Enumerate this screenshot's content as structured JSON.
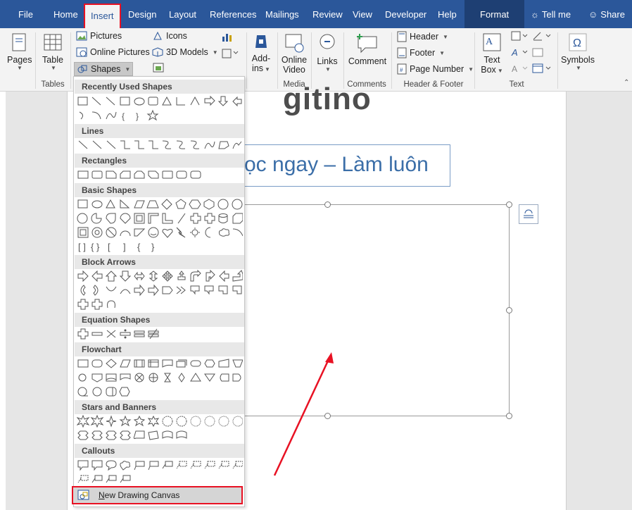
{
  "tabs": [
    "File",
    "Home",
    "Insert",
    "Design",
    "Layout",
    "References",
    "Mailings",
    "Review",
    "View",
    "Developer",
    "Help",
    "Format"
  ],
  "tell_me": "Tell me",
  "share": "Share",
  "ribbon": {
    "pages": "Pages",
    "table": "Table",
    "pictures": "Pictures",
    "online_pictures": "Online Pictures",
    "shapes": "Shapes",
    "icons": "Icons",
    "models_3d": "3D Models",
    "addins_line1": "Add-",
    "addins_line2": "ins",
    "online_video_line1": "Online",
    "online_video_line2": "Video",
    "links": "Links",
    "comment": "Comment",
    "header": "Header",
    "footer": "Footer",
    "page_number": "Page Number",
    "text_box_line1": "Text",
    "text_box_line2": "Box",
    "symbols": "Symbols",
    "groups": {
      "tables": "Tables",
      "media": "Media",
      "comments": "Comments",
      "header_footer": "Header & Footer",
      "text": "Text"
    }
  },
  "doc": {
    "logo": "gitino",
    "title": "ọc ngay – Làm luôn"
  },
  "shapes_menu": {
    "recently_used": "Recently Used Shapes",
    "lines": "Lines",
    "rectangles": "Rectangles",
    "basic_shapes": "Basic Shapes",
    "block_arrows": "Block Arrows",
    "equation_shapes": "Equation Shapes",
    "flowchart": "Flowchart",
    "stars_banners": "Stars and Banners",
    "callouts": "Callouts",
    "new_drawing_canvas": "New Drawing Canvas"
  },
  "colors": {
    "accent": "#2b579a",
    "highlight": "#e81123"
  }
}
